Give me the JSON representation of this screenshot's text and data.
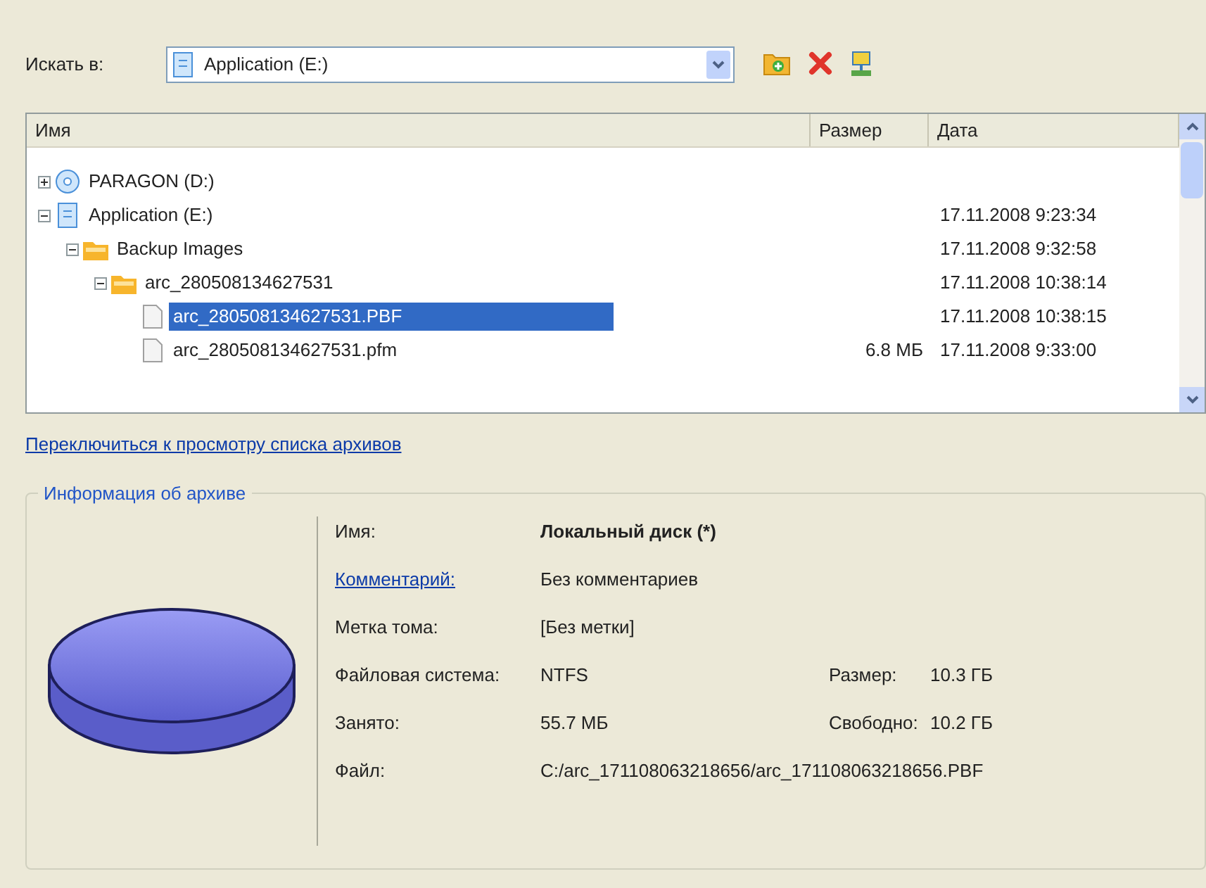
{
  "search_in": {
    "label": "Искать в:",
    "value": "Application (E:)"
  },
  "file_list": {
    "columns": [
      "Имя",
      "Размер",
      "Дата"
    ],
    "items": [
      {
        "name": "PARAGON (D:)",
        "kind": "cd",
        "expanded": false,
        "selected": false
      },
      {
        "name": "Application (E:)",
        "kind": "drive",
        "expanded": true,
        "date": "17.11.2008 9:23:34",
        "selected": false,
        "children": [
          {
            "name": "Backup Images",
            "kind": "folder",
            "expanded": true,
            "date": "17.11.2008 9:32:58",
            "selected": false,
            "children": [
              {
                "name": "arc_280508134627531",
                "kind": "folder",
                "expanded": true,
                "date": "17.11.2008 10:38:14",
                "selected": false,
                "children": [
                  {
                    "name": "arc_280508134627531.PBF",
                    "kind": "file",
                    "date": "17.11.2008 10:38:15",
                    "selected": true
                  },
                  {
                    "name": "arc_280508134627531.pfm",
                    "kind": "file",
                    "size": "6.8 МБ",
                    "date": "17.11.2008 9:33:00",
                    "selected": false
                  }
                ]
              }
            ]
          }
        ]
      }
    ]
  },
  "switch_link": "Переключиться к просмотру списка архивов",
  "archive_info": {
    "title": "Информация об архиве",
    "rows": [
      {
        "label": "Имя:",
        "label_link": false,
        "value": "Локальный диск (*)",
        "value_bold": true
      },
      {
        "label": "Комментарий:",
        "label_link": true,
        "value": "Без комментариев",
        "value_bold": false
      },
      {
        "label": "Метка тома:",
        "label_link": false,
        "value": "[Без метки]",
        "value_bold": false
      },
      {
        "label": "Файловая система:",
        "label_link": false,
        "value": "NTFS",
        "value_bold": false,
        "extra_label": "Размер:",
        "extra_value": "10.3 ГБ"
      },
      {
        "label": "Занято:",
        "label_link": false,
        "value": "55.7 МБ",
        "value_bold": false,
        "extra_label": "Свободно:",
        "extra_value": "10.2 ГБ"
      },
      {
        "label": "Файл:",
        "label_link": false,
        "value": "C:/arc_171108063218656/arc_171108063218656.PBF",
        "value_bold": false
      }
    ]
  }
}
